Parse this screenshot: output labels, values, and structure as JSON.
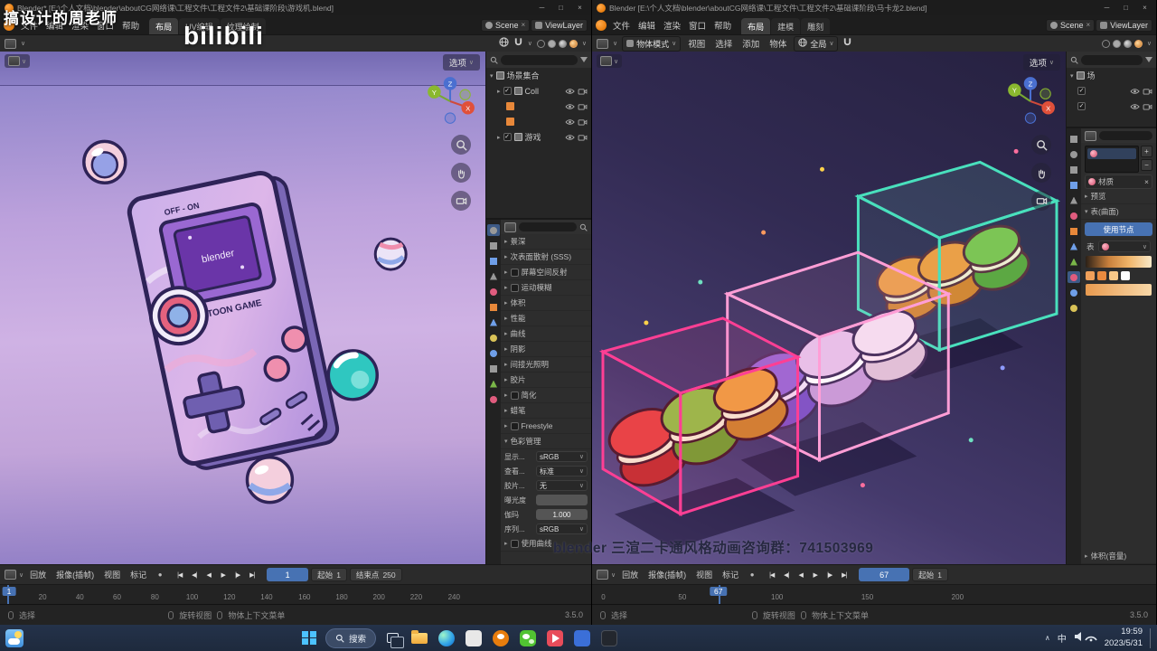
{
  "colors": {
    "accent": "#4772b3",
    "blender_orange": "#e87d0d",
    "header_bg": "#2b2b2b",
    "viewport_left": "#c2a5de",
    "viewport_right": "#342c55",
    "playhead": "#4772b3",
    "use_nodes_button": "#4772b3",
    "taskbar_bg": "#1f2c3e"
  },
  "icons": {
    "minimize": "─",
    "maximize": "□",
    "close": "×",
    "caret_down": "▾",
    "caret_right": "▸",
    "chevron_down": "∨",
    "chevron_up": "∧",
    "check": "✓",
    "record": "●",
    "jump_start": "|◀",
    "key_prev": "◀|",
    "play_rev": "◀",
    "play": "▶",
    "key_next": "|▶",
    "jump_end": "▶|",
    "x_small": "×",
    "plus": "+",
    "minus": "−"
  },
  "gizmo": {
    "x": "X",
    "y": "Y",
    "z": "Z"
  },
  "overlays": {
    "teacher": "搞设计的周老师",
    "bilibili": "bilibili",
    "qq_banner": "blender 三渲二卡通风格动画咨询群：741503969"
  },
  "left": {
    "title": "Blender* [E:\\个人文档\\blender\\aboutCG网络课\\工程文件\\工程文件2\\基础课阶段\\游戏机.blend]",
    "menus": [
      "文件",
      "编辑",
      "渲染",
      "窗口",
      "帮助"
    ],
    "tabs": [
      "布局",
      "UV编辑",
      "纹理绘制"
    ],
    "scene": "Scene",
    "viewlayer": "ViewLayer",
    "viewport": {
      "options": "选项",
      "gameboy": {
        "switch_label": "OFF - ON",
        "screen_text": "blender",
        "brand": "TOON GAME"
      }
    },
    "outliner": {
      "scene_collection": "场景集合",
      "coll": "Coll",
      "game": "游戏"
    },
    "props": {
      "sections": [
        "景深",
        "次表面散射 (SSS)",
        "屏幕空间反射",
        "运动模糊",
        "体积",
        "性能",
        "曲线",
        "阴影",
        "间接光照明",
        "胶片",
        "简化",
        "蜡笔",
        "Freestyle"
      ],
      "color_management": "色彩管理",
      "cm": [
        {
          "label": "显示...",
          "value": "sRGB"
        },
        {
          "label": "查看...",
          "value": "标准"
        },
        {
          "label": "胶片...",
          "value": "无"
        },
        {
          "label": "曝光度",
          "value": ""
        },
        {
          "label": "伽玛",
          "value": "1.000"
        },
        {
          "label": "序列...",
          "value": "sRGB"
        }
      ],
      "use_curves": "使用曲线"
    },
    "timeline": {
      "menus": [
        "回放",
        "报像(插帧)",
        "视图",
        "标记"
      ],
      "frame": "1",
      "start_label": "起始",
      "start_value": "1",
      "end_label": "结束点",
      "end_value": "250"
    },
    "ruler": {
      "current": "1",
      "ticks": [
        "20",
        "40",
        "60",
        "80",
        "100",
        "120",
        "140",
        "160",
        "180",
        "200",
        "220",
        "240"
      ]
    },
    "status": {
      "select": "选择",
      "rotate": "旋转视图",
      "context": "物体上下文菜单",
      "version": "3.5.0"
    }
  },
  "right": {
    "title": "Blender [E:\\个人文档\\blender\\aboutCG网络课\\工程文件\\工程文件2\\基础课阶段\\马卡龙2.blend]",
    "menus": [
      "文件",
      "编辑",
      "渲染",
      "窗口",
      "帮助"
    ],
    "tabs": [
      "布局",
      "建模",
      "雕刻"
    ],
    "scene": "Scene",
    "viewlayer": "ViewLayer",
    "toolbar": {
      "mode": "物体模式",
      "menus": [
        "视图",
        "选择",
        "添加",
        "物体"
      ],
      "orientation": "全局"
    },
    "viewport": {
      "options": "选项"
    },
    "outliner": {
      "root": "场"
    },
    "props": {
      "material_name": "材质",
      "preview": "预览",
      "surface": "表(曲面)",
      "use_nodes": "使用节点",
      "surface_label": "表",
      "volume": "体积(音量)"
    },
    "timeline": {
      "menus": [
        "回放",
        "报像(插帧)",
        "视图",
        "标记"
      ],
      "frame": "67",
      "start_label": "起始",
      "start_value": "1"
    },
    "ruler": {
      "current": "67",
      "ticks": [
        "0",
        "50",
        "100",
        "150",
        "200"
      ]
    },
    "status": {
      "select": "选择",
      "rotate": "旋转视图",
      "context": "物体上下文菜单",
      "version": "3.5.0"
    }
  },
  "taskbar": {
    "search_label": "搜索",
    "input_method": "中",
    "time": "19:59",
    "date": "2023/5/31"
  }
}
